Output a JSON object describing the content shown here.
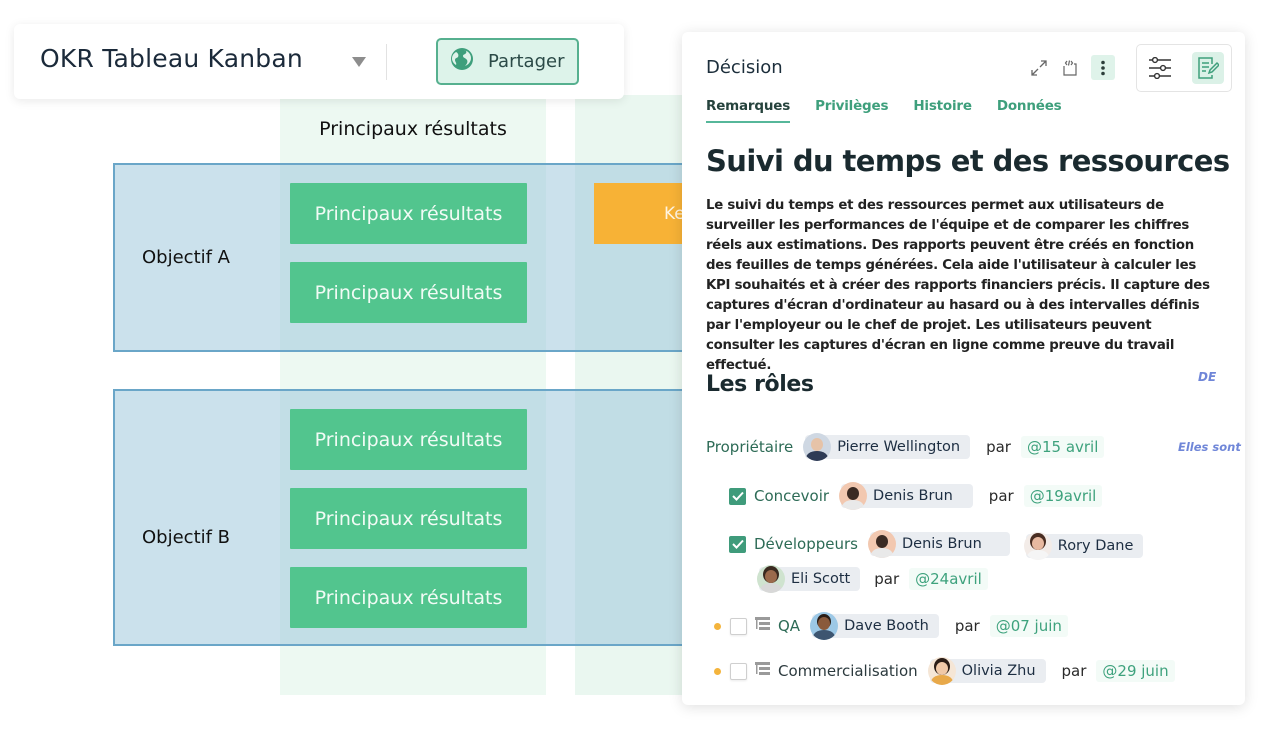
{
  "toolbar": {
    "board_title": "OKR Tableau Kanban",
    "share_label": "Partager",
    "share_icon": "globe-icon",
    "dropdown_icon": "caret-down-icon"
  },
  "board": {
    "column_header": "Principaux résultats",
    "objectives": [
      {
        "label": "Objectif A",
        "cards": [
          "Principaux résultats",
          "Principaux résultats"
        ]
      },
      {
        "label": "Objectif B",
        "cards": [
          "Principaux résultats",
          "Principaux résultats",
          "Principaux résultats"
        ]
      }
    ],
    "partial_card_label": "Ke",
    "colors": {
      "lane": "#c5e0ea",
      "lane_border": "#6aa6c8",
      "card_green": "#52c58e",
      "card_orange": "#f7b236",
      "column_bg": "#edf9f2"
    }
  },
  "panel": {
    "title": "Décision",
    "header_icons": [
      "expand-icon",
      "embed-code-icon",
      "more-vertical-icon"
    ],
    "tool_icons": [
      "filter-sliders-icon",
      "edit-notes-icon"
    ],
    "tabs": [
      {
        "label": "Remarques",
        "active": true
      },
      {
        "label": "Privilèges",
        "active": false
      },
      {
        "label": "Histoire",
        "active": false
      },
      {
        "label": "Données",
        "active": false
      }
    ],
    "doc_title": "Suivi du temps et des ressources",
    "doc_body": "Le suivi du temps et des ressources permet aux utilisateurs de surveiller les performances de l'équipe et de comparer les chiffres réels aux estimations. Des rapports peuvent être créés en fonction des feuilles de temps générées. Cela aide l'utilisateur à calculer les KPI souhaités et à créer des rapports financiers précis. Il capture des captures d'écran d'ordinateur au hasard ou à des intervalles définis par l'employeur ou le chef de projet. Les utilisateurs peuvent consulter les captures d'écran en ligne comme preuve du travail effectué.",
    "roles_title": "Les rôles",
    "tag_de": "DE",
    "tag_elles": "Elles sont",
    "par": "par",
    "roles": {
      "owner": {
        "label": "Propriétaire",
        "people": [
          "Pierre Wellington"
        ],
        "date": "@15 avril"
      },
      "design": {
        "label": "Concevoir",
        "checked": true,
        "people": [
          "Denis Brun"
        ],
        "date": "@19avril"
      },
      "dev": {
        "label": "Développeurs",
        "checked": true,
        "people": [
          "Denis Brun",
          "Rory Dane",
          "Eli Scott"
        ],
        "date": "@24avril"
      },
      "qa": {
        "label": "QA",
        "checked": false,
        "people": [
          "Dave Booth"
        ],
        "date": "@07 juin"
      },
      "marketing": {
        "label": "Commercialisation",
        "checked": false,
        "people": [
          "Olivia Zhu"
        ],
        "date": "@29 juin"
      }
    },
    "colors": {
      "accent": "#3ea27d",
      "tab_active_underline": "#56b79a",
      "pending_dot": "#f4b43c",
      "tag_blue": "#6f86d8"
    }
  }
}
